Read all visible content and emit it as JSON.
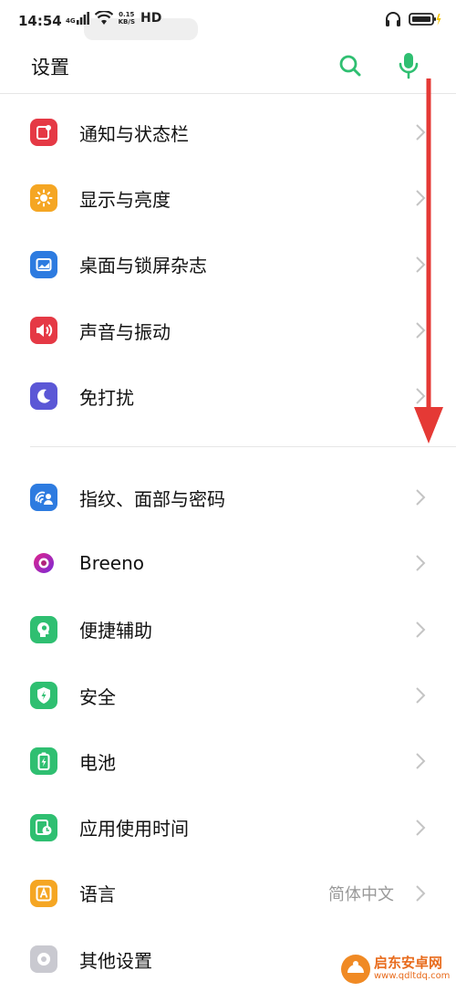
{
  "status": {
    "time": "14:54",
    "network": "4G",
    "speed_value": "0.15",
    "speed_unit": "KB/S",
    "hd": "HD"
  },
  "header": {
    "title": "设置"
  },
  "colors": {
    "accent": "#2fbf71",
    "arrow": "#e53935"
  },
  "group1": [
    {
      "label": "通知与状态栏",
      "icon": "notification-icon",
      "color": "#e53945"
    },
    {
      "label": "显示与亮度",
      "icon": "brightness-icon",
      "color": "#f5a623"
    },
    {
      "label": "桌面与锁屏杂志",
      "icon": "wallpaper-icon",
      "color": "#2d7be0"
    },
    {
      "label": "声音与振动",
      "icon": "sound-icon",
      "color": "#e53945"
    },
    {
      "label": "免打扰",
      "icon": "moon-icon",
      "color": "#5b57d6"
    }
  ],
  "group2": [
    {
      "label": "指纹、面部与密码",
      "icon": "fingerprint-icon",
      "color": "#2d7be0",
      "value": ""
    },
    {
      "label": "Breeno",
      "icon": "breeno-icon",
      "color": "#ffffff",
      "value": ""
    },
    {
      "label": "便捷辅助",
      "icon": "assist-icon",
      "color": "#2fbf71",
      "value": ""
    },
    {
      "label": "安全",
      "icon": "security-shield-icon",
      "color": "#2fbf71",
      "value": ""
    },
    {
      "label": "电池",
      "icon": "battery-icon",
      "color": "#2fbf71",
      "value": ""
    },
    {
      "label": "应用使用时间",
      "icon": "app-usage-icon",
      "color": "#2fbf71",
      "value": ""
    },
    {
      "label": "语言",
      "icon": "language-icon",
      "color": "#f5a623",
      "value": "简体中文"
    },
    {
      "label": "其他设置",
      "icon": "other-settings-icon",
      "color": "#c9c9d0",
      "value": ""
    }
  ],
  "watermark": {
    "name": "启东安卓网",
    "url": "www.qdltdq.com"
  }
}
